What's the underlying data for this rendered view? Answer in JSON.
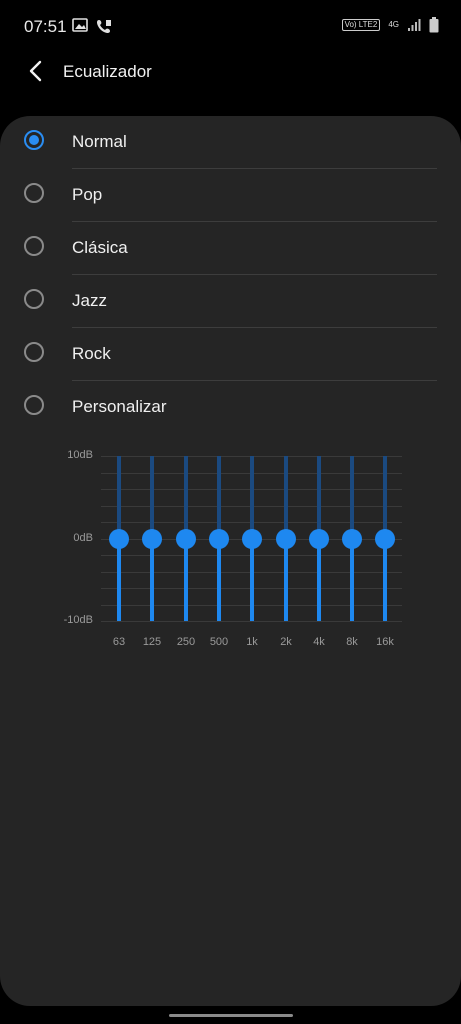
{
  "status": {
    "time": "07:51",
    "left_icons": [
      "image-icon",
      "wifi-call-icon"
    ],
    "volte": "Vo) LTE2",
    "network": "4G",
    "right_icons": [
      "signal-icon",
      "battery-icon"
    ]
  },
  "appbar": {
    "title": "Ecualizador",
    "back_icon": "chevron-left-icon"
  },
  "options": [
    {
      "label": "Normal",
      "selected": true
    },
    {
      "label": "Pop",
      "selected": false
    },
    {
      "label": "Clásica",
      "selected": false
    },
    {
      "label": "Jazz",
      "selected": false
    },
    {
      "label": "Rock",
      "selected": false
    },
    {
      "label": "Personalizar",
      "selected": false
    }
  ],
  "equalizer": {
    "db_labels": {
      "top": "10dB",
      "mid": "0dB",
      "bottom": "-10dB"
    },
    "bands": [
      {
        "freq": "63",
        "gain_db": 0
      },
      {
        "freq": "125",
        "gain_db": 0
      },
      {
        "freq": "250",
        "gain_db": 0
      },
      {
        "freq": "500",
        "gain_db": 0
      },
      {
        "freq": "1k",
        "gain_db": 0
      },
      {
        "freq": "2k",
        "gain_db": 0
      },
      {
        "freq": "4k",
        "gain_db": 0
      },
      {
        "freq": "8k",
        "gain_db": 0
      },
      {
        "freq": "16k",
        "gain_db": 0
      }
    ],
    "range_db": [
      -10,
      10
    ]
  },
  "colors": {
    "accent": "#1e88f0",
    "card": "#252525",
    "background": "#000000"
  }
}
